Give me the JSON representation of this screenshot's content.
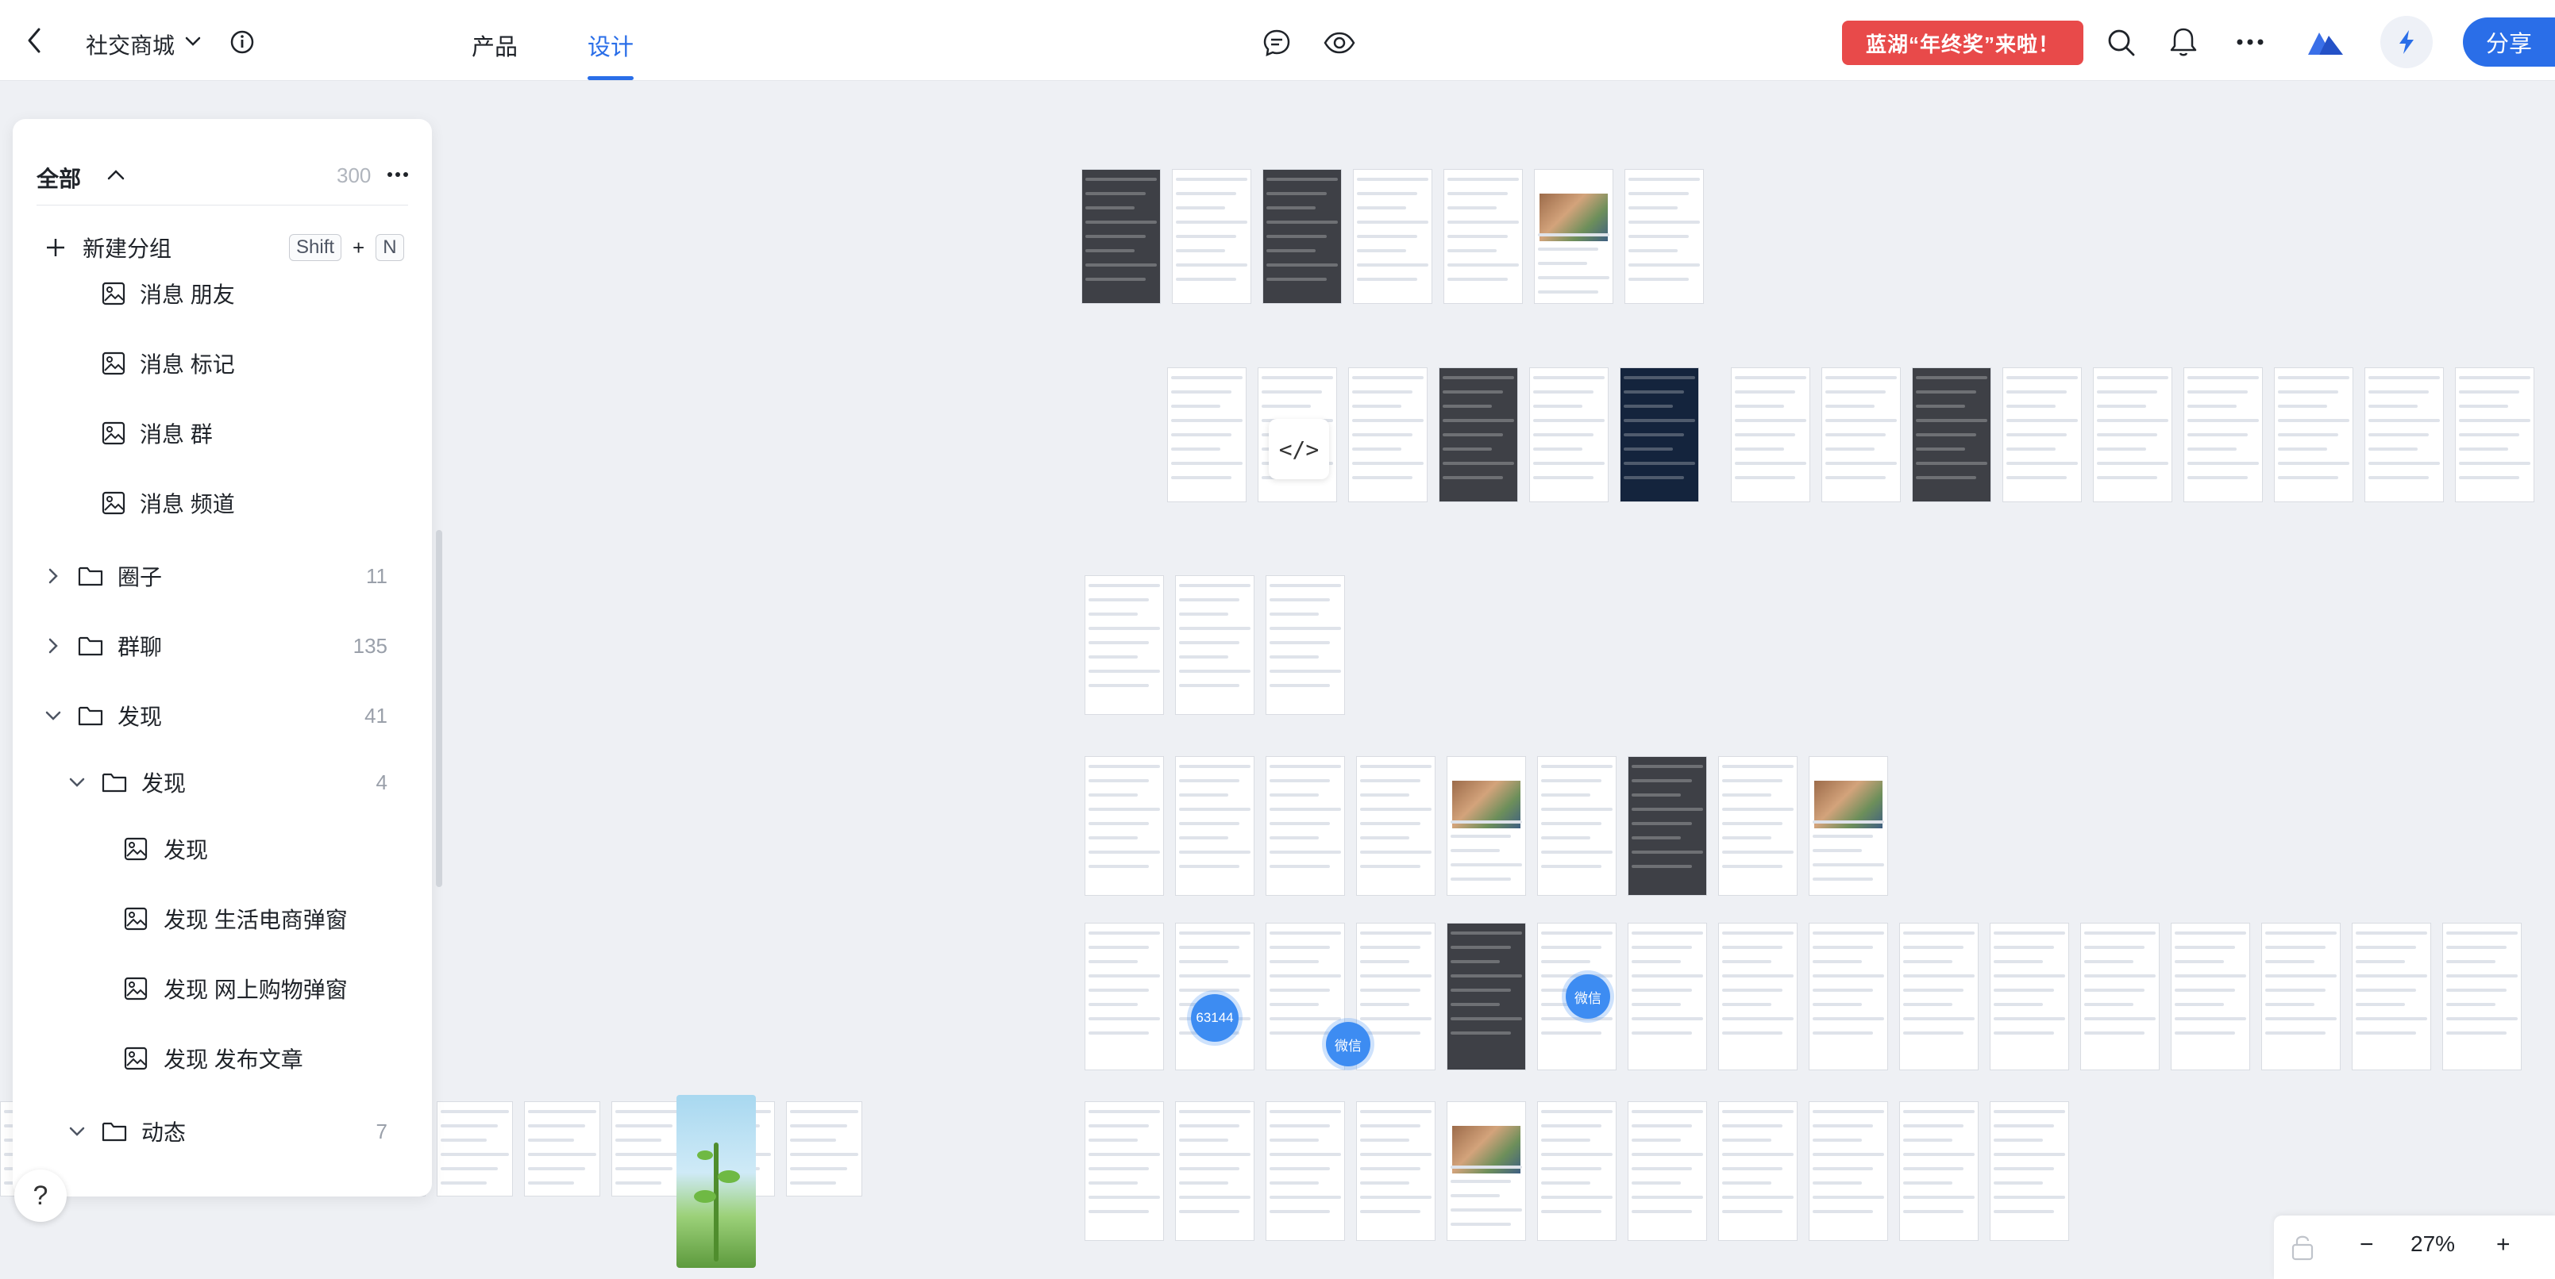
{
  "header": {
    "project_title": "社交商城",
    "tabs": [
      {
        "label": "产品"
      },
      {
        "label": "设计"
      }
    ],
    "promo_text": "蓝湖“年终奖”来啦！",
    "share_label": "分享"
  },
  "panel": {
    "filter_label": "全部",
    "total_count": "300",
    "new_group_label": "新建分组",
    "shortcut": {
      "key1": "Shift",
      "plus": "+",
      "key2": "N"
    },
    "items": [
      {
        "label": "消息 朋友"
      },
      {
        "label": "消息 标记"
      },
      {
        "label": "消息 群"
      },
      {
        "label": "消息 频道"
      },
      {
        "label": "圈子",
        "count": "11"
      },
      {
        "label": "群聊",
        "count": "135"
      },
      {
        "label": "发现",
        "count": "41"
      },
      {
        "label": "发现",
        "count": "4"
      },
      {
        "label": "发现"
      },
      {
        "label": "发现 生活电商弹窗"
      },
      {
        "label": "发现 网上购物弹窗"
      },
      {
        "label": "发现 发布文章"
      },
      {
        "label": "动态",
        "count": "7"
      }
    ]
  },
  "canvas": {
    "badge_count": "63144",
    "wechat_label_1": "微信",
    "wechat_label_2": "微信",
    "code_label": "</>"
  },
  "zoom": {
    "level": "27%",
    "minus": "−",
    "plus": "+"
  },
  "help_label": "?",
  "colors": {
    "accent": "#2a6ee8",
    "promo": "#e84a4a"
  }
}
